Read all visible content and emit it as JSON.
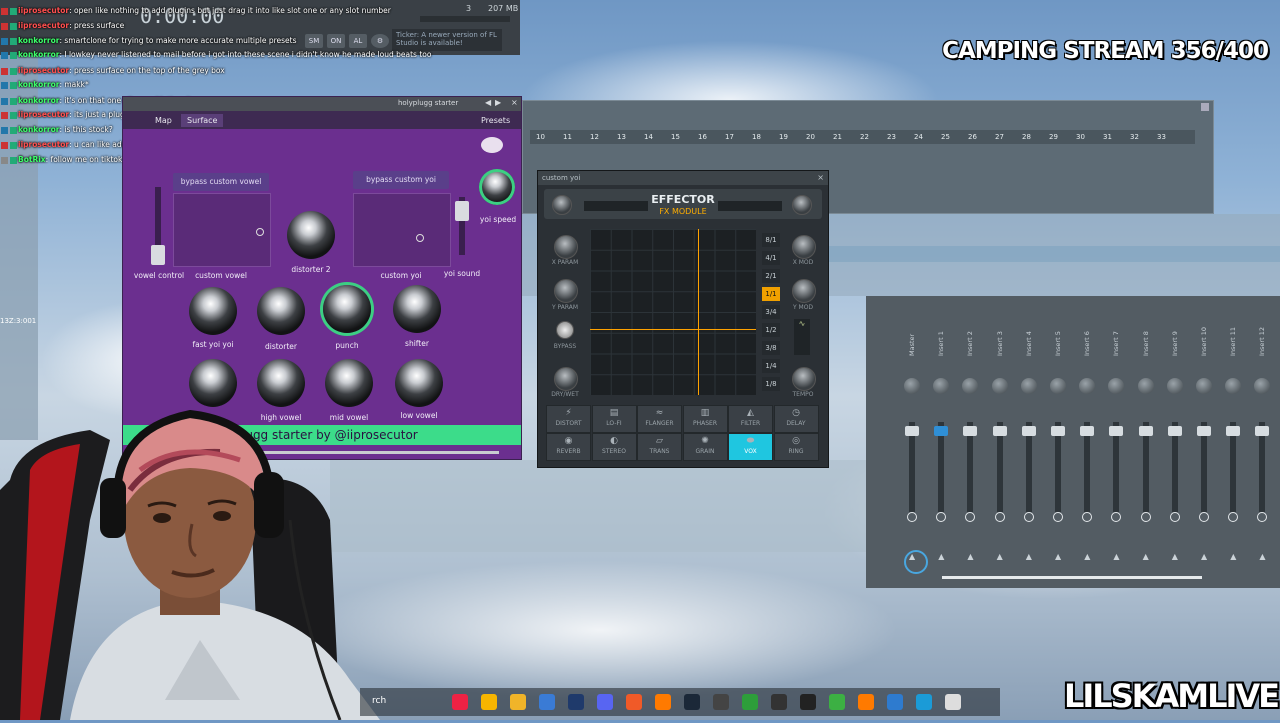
{
  "overlay": {
    "stream_title": "CAMPING STREAM 356/400",
    "brand": "LILSKAMLIVE"
  },
  "toolbar": {
    "time": "0:00:00",
    "memory": "207 MB",
    "voices": "3",
    "news": "Ticker: A newer version of FL Studio is available!",
    "buttons": [
      "SM",
      "ON",
      "AL"
    ]
  },
  "chat": [
    {
      "user": "iiprosecutor",
      "text": ": open like nothing to add plugins but just drag it into like slot one or any slot number",
      "color": "#ff4f4f"
    },
    {
      "user": "iiprosecutor",
      "text": ": press surface",
      "color": "#ff4f4f"
    },
    {
      "user": "konkorror",
      "text": ": smartclone for trying to make more accurate multiple presets",
      "color": "#3cff6a"
    },
    {
      "user": "konkorror",
      "text": ": I lowkey never listened to mail before i got into these scene i didn't know he made loud beats too",
      "color": "#3cff6a"
    },
    {
      "user": "iiprosecutor",
      "text": ": press surface on the top of the grey box",
      "color": "#ff4f4f"
    },
    {
      "user": "konkorror",
      "text": ": makk*",
      "color": "#3cff6a"
    },
    {
      "user": "konkorror",
      "text": ": it's on that one album with the city cover",
      "color": "#3cff6a"
    },
    {
      "user": "iiprosecutor",
      "text": ": its just a plugin",
      "color": "#ff4f4f"
    },
    {
      "user": "konkorror",
      "text": ": is this stock?",
      "color": "#3cff6a"
    },
    {
      "user": "iiprosecutor",
      "text": ": u can like add a base 808 and then use the wheels to add distortion",
      "color": "#ff4f4f"
    },
    {
      "user": "BotRix",
      "text": ": follow me on tiktok https://www.tiktok.com/@lilskamlive",
      "color": "#3cff6a"
    }
  ],
  "left_panel_label": "13Z:3:001",
  "playlist": {
    "ticks": [
      "10",
      "11",
      "12",
      "13",
      "14",
      "15",
      "16",
      "17",
      "18",
      "19",
      "20",
      "21",
      "22",
      "23",
      "24",
      "25",
      "26",
      "27",
      "28",
      "29",
      "30",
      "31",
      "32",
      "33"
    ]
  },
  "holyplugg": {
    "title": "holyplugg starter",
    "tabs": [
      "Map",
      "Surface"
    ],
    "presets_label": "Presets",
    "pad1_label": "bypass custom vowel",
    "pad2_label": "bypass custom yoi",
    "labels": {
      "vowel_control": "vowel control",
      "custom_vowel": "custom vowel",
      "distorter2": "distorter 2",
      "custom_yoi": "custom yoi",
      "yoi_sound": "yoi sound",
      "yoi_speed": "yoi speed",
      "fast_yoi": "fast yoi yoi",
      "distorter": "distorter",
      "punch": "punch",
      "shifter": "shifter",
      "high_vowel": "high vowel",
      "mid_vowel": "mid vowel",
      "low_vowel": "low vowel"
    },
    "footer": "holyplugg starter by @iiprosecutor"
  },
  "effector": {
    "window_title": "custom yoi",
    "name": "EFFECTOR",
    "subtitle": "FX MODULE",
    "left_labels": [
      "X PARAM",
      "Y PARAM",
      "BYPASS",
      "DRY/WET"
    ],
    "right_labels": [
      "X MOD",
      "Y MOD",
      "TEMPO"
    ],
    "rates": [
      "8/1",
      "4/1",
      "2/1",
      "1/1",
      "3/4",
      "1/2",
      "3/8",
      "1/4",
      "1/8"
    ],
    "selected_rate": "1/1",
    "effects_row1": [
      "DISTORT",
      "LO-FI",
      "FLANGER",
      "PHASER",
      "FILTER",
      "DELAY"
    ],
    "effects_row2": [
      "REVERB",
      "STEREO",
      "TRANS",
      "GRAIN",
      "VOX",
      "RING"
    ],
    "selected_effect": "VOX"
  },
  "mixer": {
    "strips": [
      "Master",
      "Insert 1",
      "Insert 2",
      "Insert 3",
      "Insert 4",
      "Insert 5",
      "Insert 6",
      "Insert 7",
      "Insert 8",
      "Insert 9",
      "Insert 10",
      "Insert 11",
      "Insert 12"
    ]
  },
  "taskbar": {
    "search": "rch",
    "icons": [
      "ai-icon",
      "chrome-icon",
      "folder-icon",
      "files-icon",
      "photoshop-icon",
      "discord-icon",
      "brave-icon",
      "fl-icon",
      "steam-icon",
      "app-icon",
      "game-icon",
      "4k-icon",
      "cap-icon",
      "green-icon",
      "fl2-icon",
      "docs-icon",
      "store-icon",
      "file-icon"
    ]
  }
}
